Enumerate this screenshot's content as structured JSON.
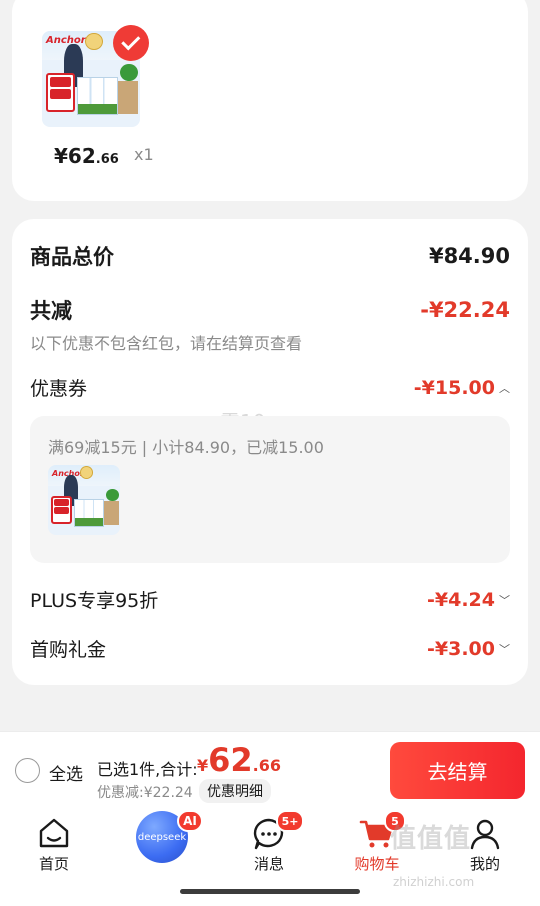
{
  "product": {
    "image_icon": "anchor-milk-product-image",
    "brand": "Anchor",
    "price_int": "¥62",
    "price_dec": ".66",
    "qty": "x1"
  },
  "summary": {
    "total_label": "商品总价",
    "total_value": "¥84.90",
    "reduce_label": "共减",
    "reduce_value": "-¥22.24",
    "note": "以下优惠不包含红包，请在结算页查看",
    "coupon_label": "优惠券",
    "coupon_value": "-¥15.00",
    "coupon_detail": "满69减15元 | 小计84.90，已减15.00",
    "watermark": "雷10",
    "plus_label": "PLUS专享95折",
    "plus_value": "-¥4.24",
    "first_label": "首购礼金",
    "first_value": "-¥3.00"
  },
  "checkout": {
    "select_all": "全选",
    "selected_text": "已选1件,合计:",
    "total_currency": "¥",
    "total_int": "62",
    "total_dec": ".66",
    "saved_text": "优惠减:¥22.24",
    "detail_button": "优惠明细",
    "pay_button": "去结算"
  },
  "tabbar": {
    "home": "首页",
    "deepseek": "deepseek",
    "ai_badge": "AI",
    "messages": "消息",
    "messages_badge": "5+",
    "cart": "购物车",
    "cart_badge": "5",
    "mine": "我的"
  },
  "watermark": {
    "site": "值值值",
    "url": "zhizhizhi.com"
  },
  "colors": {
    "accent_red": "#e23a2a",
    "pay_button": "#f4262e",
    "deepseek_blue": "#3c6cf2"
  }
}
